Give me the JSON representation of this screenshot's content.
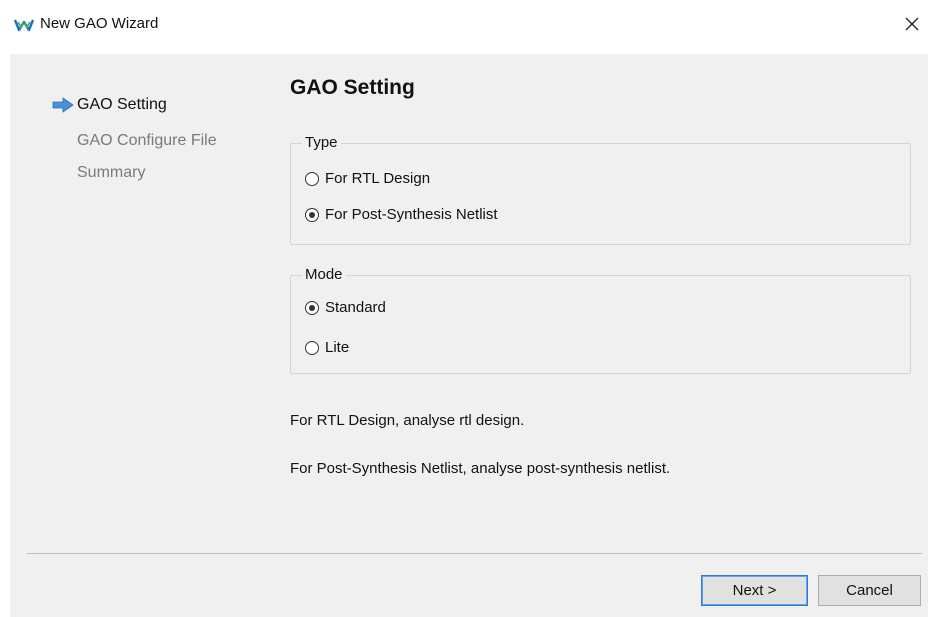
{
  "window": {
    "title": "New GAO Wizard",
    "close_glyph": "×"
  },
  "steps": [
    {
      "label": "GAO Setting",
      "state": "current"
    },
    {
      "label": "GAO Configure File",
      "state": "pending"
    },
    {
      "label": "Summary",
      "state": "pending"
    }
  ],
  "page": {
    "title": "GAO Setting"
  },
  "type_group": {
    "label": "Type",
    "options": [
      {
        "label": "For RTL Design",
        "selected": false
      },
      {
        "label": "For Post-Synthesis Netlist",
        "selected": true
      }
    ]
  },
  "mode_group": {
    "label": "Mode",
    "options": [
      {
        "label": "Standard",
        "selected": true
      },
      {
        "label": "Lite",
        "selected": false
      }
    ]
  },
  "descriptions": [
    "For RTL Design, analyse rtl design.",
    "For Post-Synthesis Netlist, analyse post-synthesis netlist."
  ],
  "buttons": {
    "next": "Next >",
    "cancel": "Cancel"
  },
  "colors": {
    "arrow": "#4a90d9",
    "client_bg": "#f0f0f0",
    "default_button_border": "#2d7bd8"
  },
  "icons": {
    "app": "gowin-logo-icon",
    "step": "arrow-right-icon",
    "close": "close-icon"
  }
}
